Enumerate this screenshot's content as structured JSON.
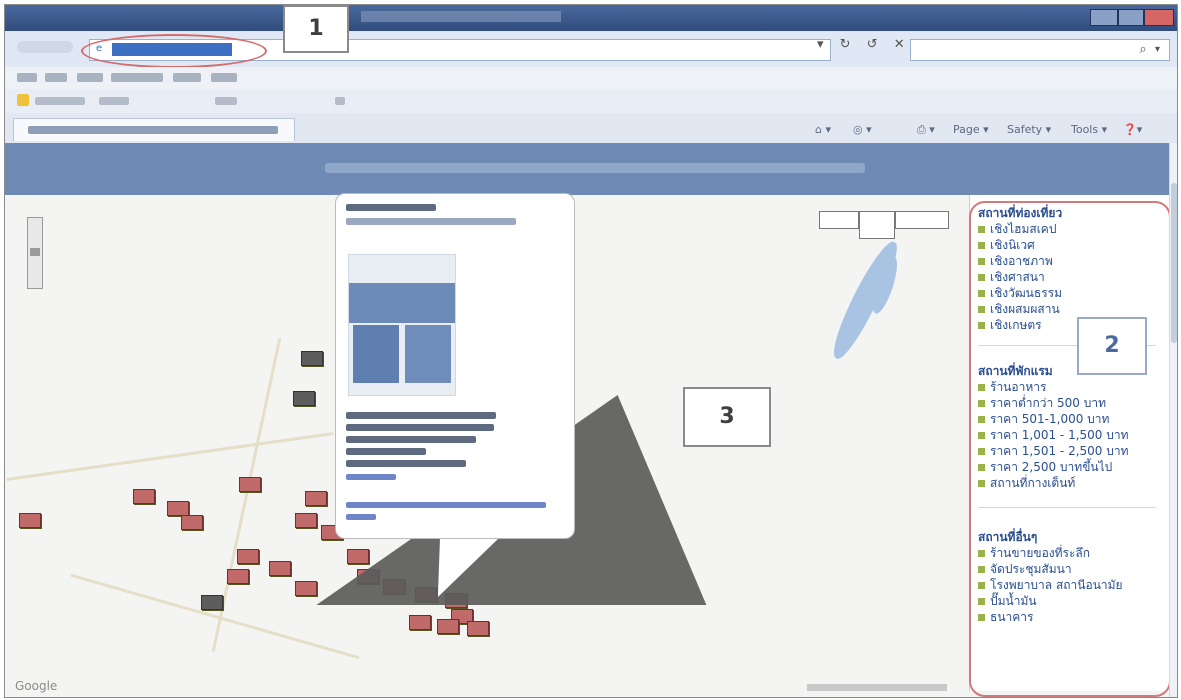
{
  "legend": {
    "sections": [
      {
        "title": "สถานที่ท่องเที่ยว",
        "items": [
          "เชิงไฮมสเคป",
          "เชิงนิเวศ",
          "เชิงอาชภาพ",
          "เชิงศาสนา",
          "เชิงวัฒนธรรม",
          "เชิงผสมผสาน",
          "เชิงเกษตร"
        ]
      },
      {
        "title": "สถานที่พักแรม",
        "items": [
          "ร้านอาหาร",
          "ราคาต่ำกว่า 500 บาท",
          "ราคา 501-1,000 บาท",
          "ราคา 1,001 - 1,500 บาท",
          "ราคา 1,501 - 2,500 บาท",
          "ราคา 2,500 บาทขึ้นไป",
          "สถานที่กางเต็นท์"
        ]
      },
      {
        "title": "สถานที่อื่นๆ",
        "items": [
          "ร้านขายของที่ระลึก",
          "จัดประชุมสัมนา",
          "โรงพยาบาล สถานีอนามัย",
          "ปั๊มน้ำมัน",
          "ธนาคาร"
        ]
      }
    ]
  },
  "callouts": [
    "1",
    "2",
    "3"
  ],
  "toolbar": {
    "page_menu": "Page ▾",
    "safety_menu": "Safety ▾",
    "tools_menu": "Tools ▾"
  },
  "map": {
    "google_logo": "Google"
  }
}
